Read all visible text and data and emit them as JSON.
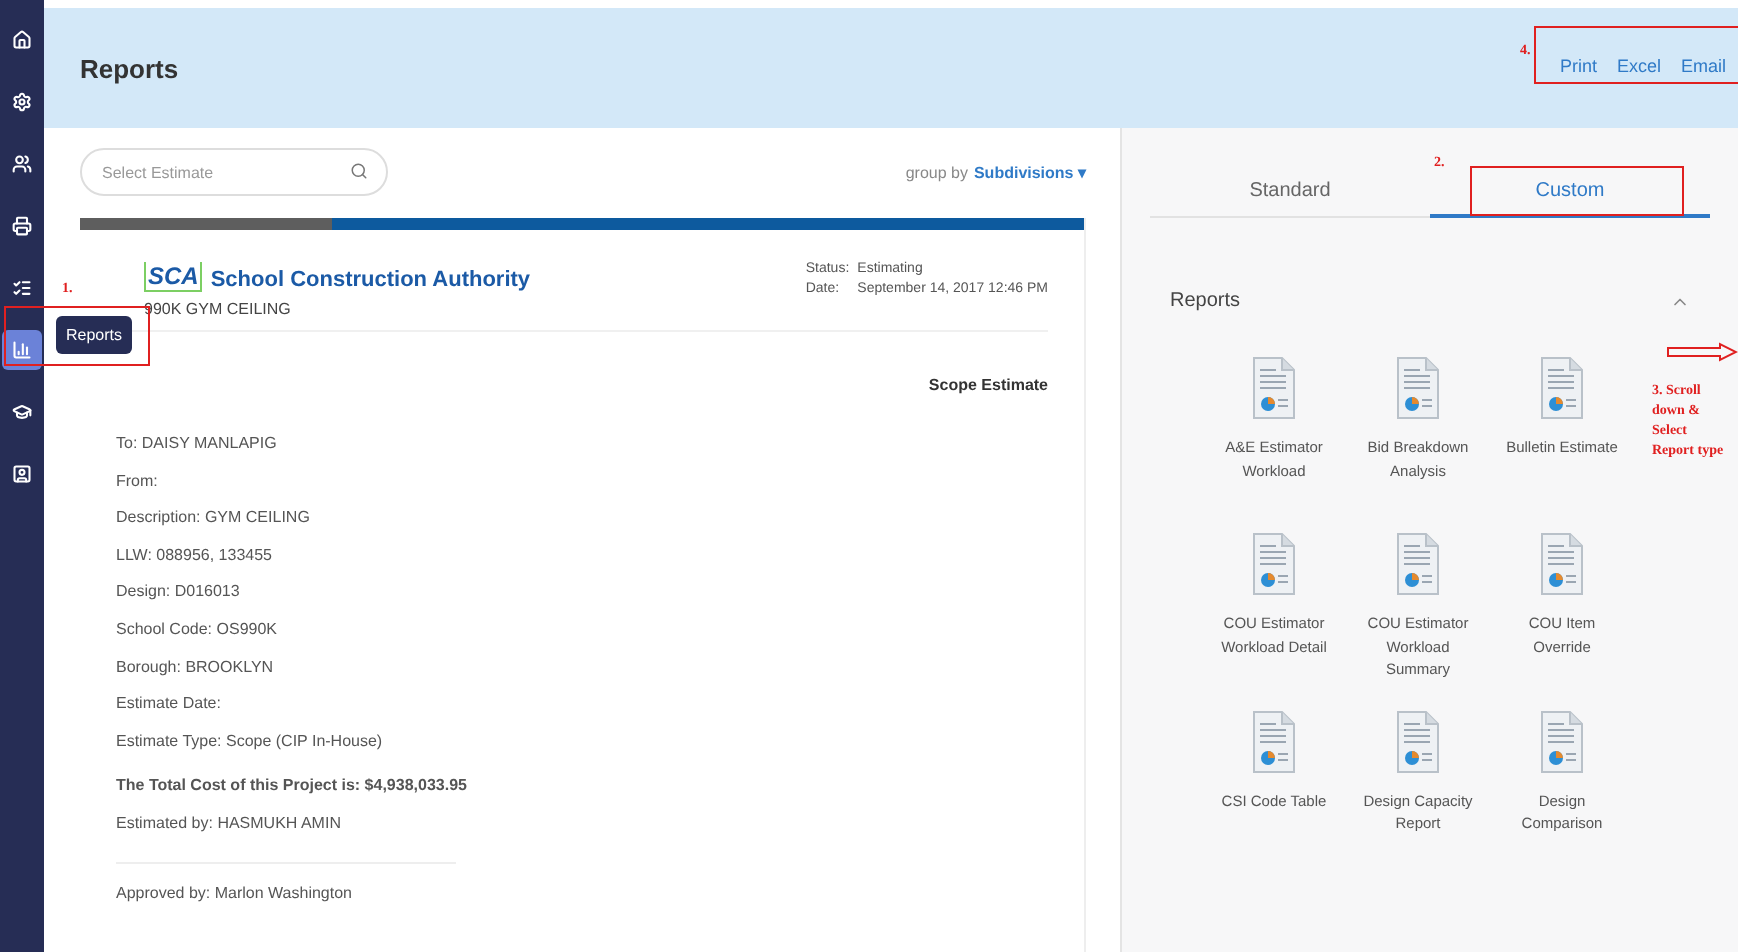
{
  "sidebar": {
    "items": [
      {
        "kind": "home",
        "selected": false
      },
      {
        "kind": "gear",
        "selected": false
      },
      {
        "kind": "users",
        "selected": false
      },
      {
        "kind": "printer",
        "selected": false
      },
      {
        "kind": "list",
        "selected": false
      },
      {
        "kind": "chart",
        "selected": true
      },
      {
        "kind": "cap",
        "selected": false
      },
      {
        "kind": "badge",
        "selected": false
      }
    ],
    "tooltip": "Reports"
  },
  "header": {
    "title": "Reports",
    "actions": [
      "Print",
      "Excel",
      "Email"
    ]
  },
  "search": {
    "placeholder": "Select Estimate"
  },
  "group_by": {
    "label": "group by",
    "value": "Subdivisions",
    "caret": "▾"
  },
  "report": {
    "logo_abbr": "SCA",
    "logo_name": "School Construction Authority",
    "subtitle": "990K GYM CEILING",
    "status_label": "Status:",
    "status": "Estimating",
    "date_label": "Date:",
    "date": "September 14, 2017 12:46 PM",
    "type": "Scope Estimate",
    "fields": [
      "To: DAISY MANLAPIG",
      "From:",
      "Description: GYM CEILING",
      "LLW: 088956, 133455",
      "Design: D016013",
      "School Code: OS990K",
      "Borough: BROOKLYN",
      "Estimate Date:",
      "Estimate Type: Scope (CIP In-House)"
    ],
    "total": "The Total Cost of this Project is: $4,938,033.95",
    "estimated_by": "Estimated by: HASMUKH AMIN",
    "approved_by": "Approved by: Marlon Washington"
  },
  "tabs": [
    {
      "label": "Standard",
      "selected": false
    },
    {
      "label": "Custom",
      "selected": true
    }
  ],
  "reports_section": {
    "title": "Reports",
    "expanded": true,
    "items": [
      "A&E Estimator Workload",
      "Bid Breakdown Analysis",
      "Bulletin Estimate",
      "COU Estimator Workload Detail",
      "COU Estimator Workload Summary",
      "COU Item Override",
      "CSI Code Table",
      "Design Capacity Report",
      "Design Comparison"
    ]
  },
  "annotations": [
    {
      "kind": "number",
      "text": "1."
    },
    {
      "kind": "number",
      "text": "2."
    },
    {
      "kind": "note",
      "text": "3. Scroll down & Select Report type"
    },
    {
      "kind": "number",
      "text": "4."
    },
    {
      "kind": "box"
    },
    {
      "kind": "box"
    },
    {
      "kind": "box"
    },
    {
      "kind": "arrow"
    }
  ]
}
